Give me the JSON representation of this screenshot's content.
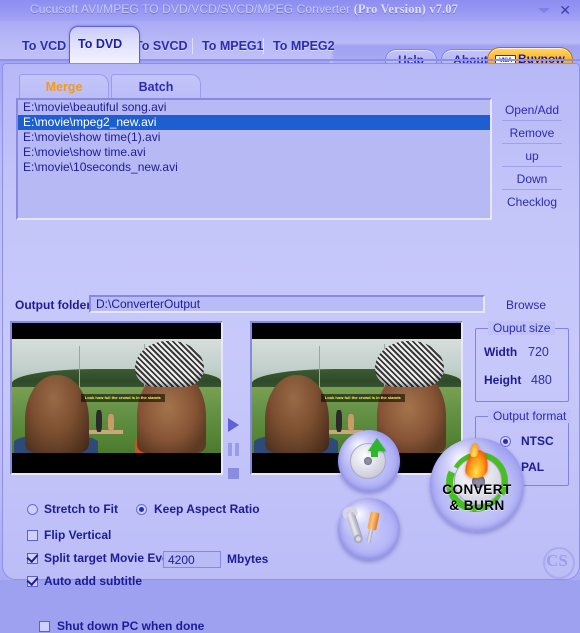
{
  "window": {
    "title_main": "Cucusoft AVI/MPEG TO DVD/VCD/SVCD/MPEG Converter",
    "title_pro": "(Pro Version)",
    "title_version": "v7.07",
    "minimize_icon": "minimize-icon",
    "close_label": "✕"
  },
  "tabs": [
    {
      "label": "To VCD",
      "active": false
    },
    {
      "label": "To DVD",
      "active": true
    },
    {
      "label": "To SVCD",
      "active": false
    },
    {
      "label": "To MPEG1",
      "active": false
    },
    {
      "label": "To MPEG2",
      "active": false
    }
  ],
  "topbuttons": {
    "help": "Help",
    "about": "About",
    "buynow": "Buynow",
    "buynow_card": "VISA"
  },
  "subtabs": {
    "merge": "Merge",
    "batch": "Batch",
    "merge_color": "#f59a0c",
    "batch_color": "#2b2bb4"
  },
  "filelist": {
    "items": [
      "E:\\movie\\beautiful song.avi",
      "E:\\movie\\mpeg2_new.avi",
      "E:\\movie\\show  time(1).avi",
      "E:\\movie\\show  time.avi",
      "E:\\movie\\10seconds_new.avi"
    ],
    "selected_index": 1,
    "selected_color": "#1d5fd0"
  },
  "sidebuttons": [
    "Open/Add",
    "Remove",
    "up",
    "Down",
    "Checklog"
  ],
  "output_folder": {
    "label": "Output folder",
    "value": "D:\\ConverterOutput",
    "placeholder": "D:\\ConverterOutput",
    "browse": "Browse"
  },
  "preview": {
    "subtitle_text": "Look how full the crowd is in the stands",
    "play": "play-icon",
    "pause": "pause-icon",
    "stop": "stop-icon"
  },
  "output_size": {
    "title": "Ouput size",
    "width_label": "Width",
    "width_value": "720",
    "height_label": "Height",
    "height_value": "480"
  },
  "output_format": {
    "title": "Output format",
    "options": [
      {
        "label": "NTSC",
        "selected": true
      },
      {
        "label": "PAL",
        "selected": false
      }
    ]
  },
  "options": {
    "stretch_to_fit": {
      "label": "Stretch to Fit",
      "selected": false
    },
    "keep_aspect_ratio": {
      "label": "Keep Aspect Ratio",
      "selected": true
    },
    "flip_vertical": {
      "label": "Flip Vertical",
      "checked": false
    },
    "split_target": {
      "label": "Split target Movie Every",
      "checked": true,
      "value": "4200",
      "unit": "Mbytes"
    },
    "auto_subtitle": {
      "label": "Auto add subtitle",
      "checked": true
    },
    "shutdown": {
      "label": "Shut down PC when done",
      "checked": false
    }
  },
  "action_buttons": {
    "convert_icon": "disc-export-icon",
    "settings_icon": "wrench-screwdriver-icon",
    "burn_line1": "CONVERT",
    "burn_line2": "& BURN"
  },
  "branding": {
    "logo_text": "CS"
  }
}
